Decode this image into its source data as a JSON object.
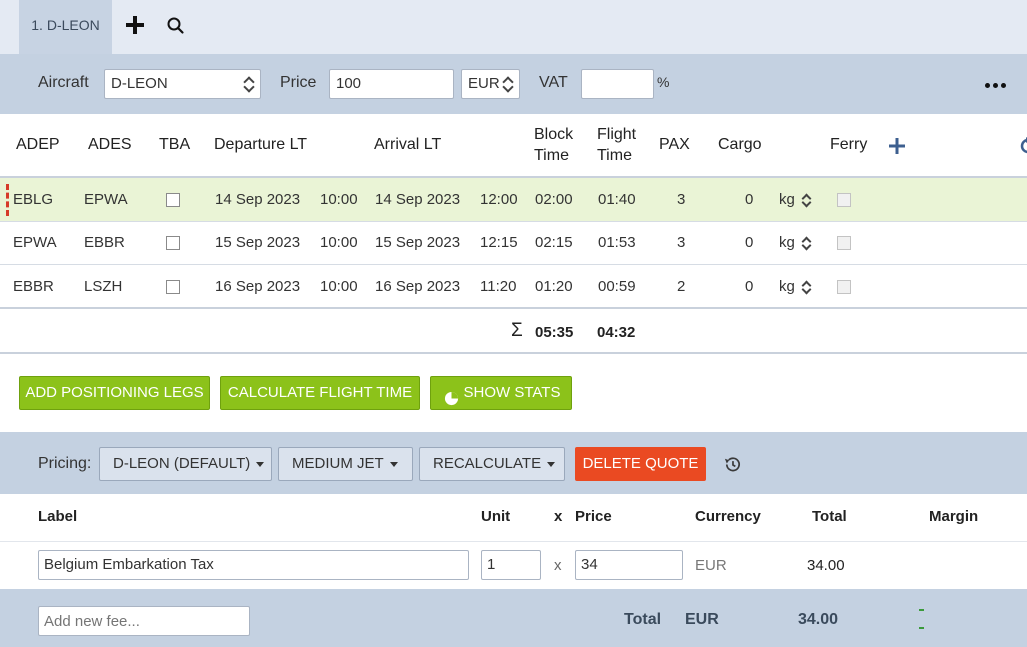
{
  "tabs": {
    "active_label": "1. D-LEON"
  },
  "aircraft_bar": {
    "aircraft_label": "Aircraft",
    "aircraft_value": "D-LEON",
    "price_label": "Price",
    "price_value": "100",
    "currency_value": "EUR",
    "vat_label": "VAT",
    "vat_value": "",
    "vat_unit": "%"
  },
  "legs": {
    "columns": {
      "adep": "ADEP",
      "ades": "ADES",
      "tba": "TBA",
      "departure": "Departure LT",
      "arrival": "Arrival LT",
      "block_time_1": "Block",
      "block_time_2": "Time",
      "flight_time_1": "Flight",
      "flight_time_2": "Time",
      "pax": "PAX",
      "cargo": "Cargo",
      "ferry": "Ferry"
    },
    "rows": [
      {
        "adep": "EBLG",
        "ades": "EPWA",
        "dep_date": "14 Sep 2023",
        "dep_time": "10:00",
        "arr_date": "14 Sep 2023",
        "arr_time": "12:00",
        "block": "02:00",
        "flight": "01:40",
        "pax": "3",
        "cargo": "0",
        "cargo_unit": "kg"
      },
      {
        "adep": "EPWA",
        "ades": "EBBR",
        "dep_date": "15 Sep 2023",
        "dep_time": "10:00",
        "arr_date": "15 Sep 2023",
        "arr_time": "12:15",
        "block": "02:15",
        "flight": "01:53",
        "pax": "3",
        "cargo": "0",
        "cargo_unit": "kg"
      },
      {
        "adep": "EBBR",
        "ades": "LSZH",
        "dep_date": "16 Sep 2023",
        "dep_time": "10:00",
        "arr_date": "16 Sep 2023",
        "arr_time": "11:20",
        "block": "01:20",
        "flight": "00:59",
        "pax": "2",
        "cargo": "0",
        "cargo_unit": "kg"
      }
    ],
    "totals": {
      "sigma": "Σ",
      "block": "05:35",
      "flight": "04:32"
    }
  },
  "actions": {
    "add_positioning": "ADD POSITIONING LEGS",
    "calculate": "CALCULATE FLIGHT TIME",
    "show_stats": "SHOW STATS"
  },
  "pricing": {
    "label": "Pricing:",
    "profile": "D-LEON (DEFAULT)",
    "category": "MEDIUM JET",
    "recalculate": "RECALCULATE",
    "delete_quote": "DELETE QUOTE"
  },
  "fees": {
    "columns": {
      "label": "Label",
      "unit": "Unit",
      "x": "x",
      "price": "Price",
      "currency": "Currency",
      "total": "Total",
      "margin": "Margin"
    },
    "rows": [
      {
        "label": "Belgium Embarkation Tax",
        "unit": "1",
        "x": "x",
        "price": "34",
        "currency": "EUR",
        "total": "34.00"
      }
    ],
    "new_fee_placeholder": "Add new fee...",
    "footer": {
      "total_label": "Total",
      "currency": "EUR",
      "amount": "34.00"
    }
  },
  "colors": {
    "accent_green": "#8cc21a",
    "danger_red": "#ea4a22",
    "bar_blue": "#c4d1e1",
    "selected_row": "#eaf4d6"
  }
}
